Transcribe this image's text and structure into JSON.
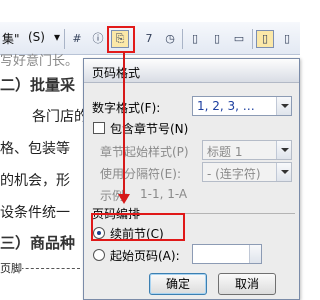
{
  "toolbar": {
    "fragment_label": "集\"",
    "s_label": "(S)",
    "s_dropdown": "▾",
    "buttons": [
      "#",
      "ⓘ",
      "⎘",
      "7",
      "◷",
      "▯",
      "▯",
      "▭",
      "▯",
      "▯"
    ]
  },
  "document": {
    "lines": [
      "写好意门长。",
      "二）批量采",
      "各门店的",
      "格、包装等",
      "的机会，形",
      "设条件统一",
      "三）商品种",
      "页脚"
    ]
  },
  "dialog": {
    "title": "页码格式",
    "number_format_label": "数字格式(F):",
    "number_format_value": "1, 2, 3, …",
    "include_chapter_label": "包含章节号(N)",
    "chapter_start_style_label": "章节起始样式(P)",
    "chapter_start_style_value": "标题 1",
    "separator_label": "使用分隔符(E):",
    "separator_value": "-  (连字符)",
    "example_label": "示例:",
    "example_value": "1-1, 1-A",
    "numbering_group_label": "页码编排",
    "continue_label": "续前节(C)",
    "start_at_label": "起始页码(A):",
    "ok_label": "确定",
    "cancel_label": "取消"
  },
  "colors": {
    "highlight_red": "#e01818",
    "link_blue": "#1d3fa0"
  }
}
